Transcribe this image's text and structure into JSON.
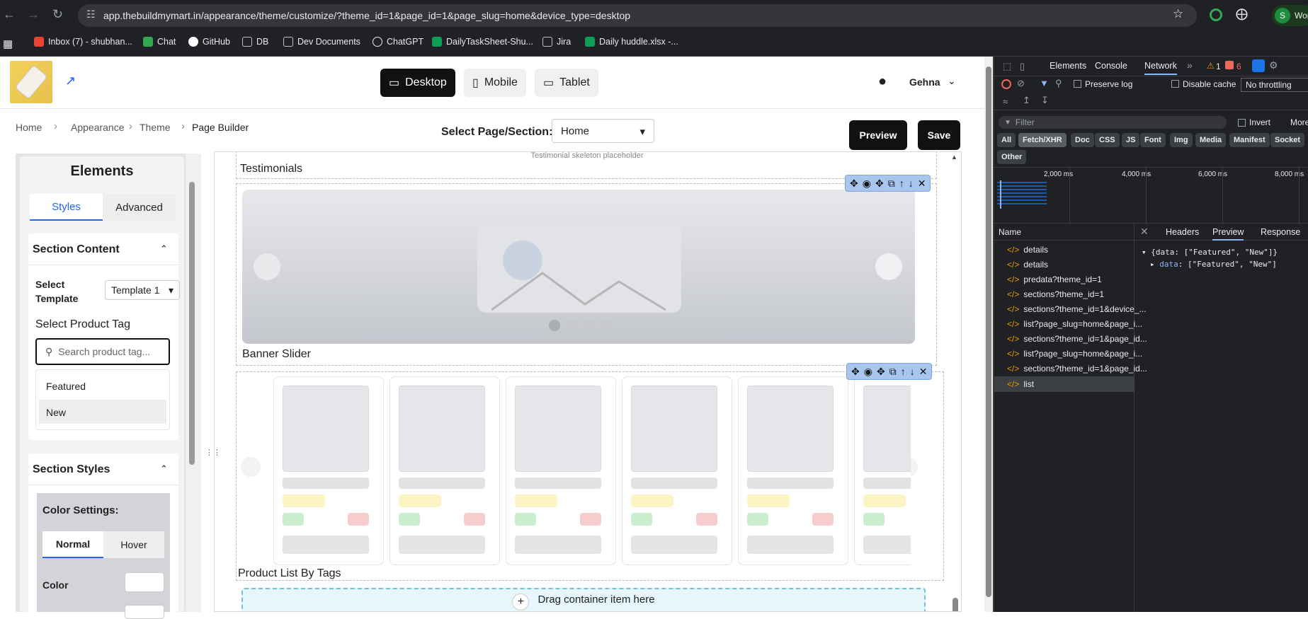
{
  "browser": {
    "url": "app.thebuildmymart.in/appearance/theme/customize/?theme_id=1&page_id=1&page_slug=home&device_type=desktop",
    "profile_initial": "S",
    "profile_text": "Wor",
    "bookmarks": [
      "Inbox (7) - shubhan...",
      "Chat",
      "GitHub",
      "DB",
      "Dev Documents",
      "ChatGPT",
      "DailyTaskSheet-Shu...",
      "Jira",
      "Daily huddle.xlsx -..."
    ]
  },
  "header": {
    "devices": [
      "Desktop",
      "Mobile",
      "Tablet"
    ],
    "active_device": "Desktop",
    "user_name": "Gehna"
  },
  "breadcrumb": [
    "Home",
    "Appearance",
    "Theme",
    "Page Builder"
  ],
  "page_select": {
    "label": "Select Page/Section:",
    "value": "Home"
  },
  "actions": {
    "preview": "Preview",
    "save": "Save"
  },
  "panel": {
    "title": "Elements",
    "tabs": [
      "Styles",
      "Advanced"
    ],
    "section_content": "Section Content",
    "select_template_label": "Select Template",
    "template_value": "Template 1",
    "product_tag_label": "Select Product Tag",
    "search_placeholder": "Search product tag...",
    "tags": [
      "Featured",
      "New"
    ],
    "section_styles": "Section Styles",
    "color_settings": "Color Settings:",
    "state_tabs": [
      "Normal",
      "Hover"
    ],
    "color_label": "Color"
  },
  "canvas": {
    "testimonials_placeholder": "Testimonial skeleton placeholder",
    "testimonials_label": "Testimonials",
    "banner_label": "Banner Slider",
    "product_list_label": "Product List By Tags",
    "drop_zone": "Drag container item here"
  },
  "devtools": {
    "tabs": [
      "Elements",
      "Console",
      "Network",
      "More"
    ],
    "warn_count": "1",
    "error_count": "6",
    "preserve_log": "Preserve log",
    "disable_cache": "Disable cache",
    "throttling": "No throttling",
    "filter_placeholder": "Filter",
    "invert": "Invert",
    "more_filters": "More",
    "type_filters": [
      "All",
      "Fetch/XHR",
      "Doc",
      "CSS",
      "JS",
      "Font",
      "Img",
      "Media",
      "Manifest",
      "Socket",
      "Other"
    ],
    "timeline_ticks": [
      "2,000 ms",
      "4,000 ms",
      "6,000 ms",
      "8,000 ms"
    ],
    "name_header": "Name",
    "detail_tabs": [
      "Headers",
      "Preview",
      "Response"
    ],
    "requests": [
      "details",
      "details",
      "predata?theme_id=1",
      "sections?theme_id=1",
      "sections?theme_id=1&device_...",
      "list?page_slug=home&page_i...",
      "sections?theme_id=1&page_id...",
      "list?page_slug=home&page_i...",
      "sections?theme_id=1&page_id...",
      "list"
    ],
    "preview_line1": "{data: [\"Featured\", \"New\"]}",
    "preview_line2_key": "data",
    "preview_line2_val": ": [\"Featured\", \"New\"]"
  }
}
